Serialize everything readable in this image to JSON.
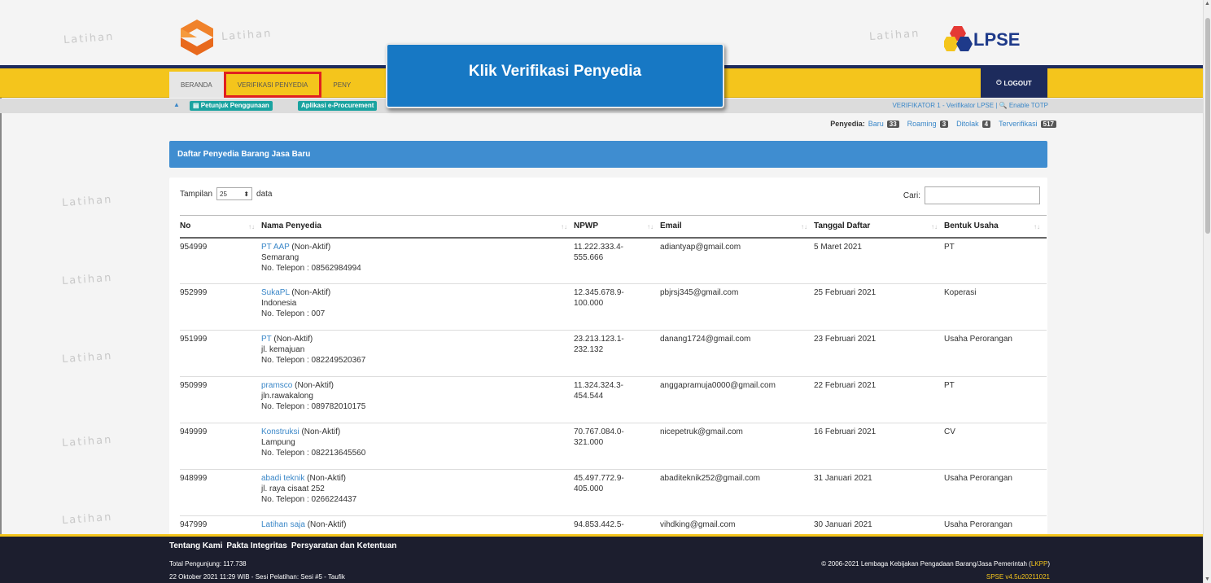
{
  "watermark": "Latihan",
  "header": {
    "lpse_label": "LPSE",
    "logout_label": "LOGOUT"
  },
  "nav": {
    "tabs": [
      {
        "label": "BERANDA"
      },
      {
        "label": "VERIFIKASI PENYEDIA"
      },
      {
        "label": "PENY"
      }
    ]
  },
  "subbar": {
    "petunjuk_label": "Petunjuk Penggunaan",
    "aplikasi_label": "Aplikasi e-Procurement",
    "user_info": "VERIFIKATOR 1 - Verifikator LPSE | ",
    "enable_totp": "Enable TOTP"
  },
  "counters": {
    "label": "Penyedia:",
    "items": [
      {
        "label": "Baru",
        "count": "33"
      },
      {
        "label": "Roaming",
        "count": "3"
      },
      {
        "label": "Ditolak",
        "count": "4"
      },
      {
        "label": "Terverifikasi",
        "count": "517"
      }
    ]
  },
  "callout": {
    "text": "Klik Verifikasi Penyedia"
  },
  "panel": {
    "title": "Daftar Penyedia Barang Jasa Baru",
    "show_label": "Tampilan",
    "page_size": "25",
    "show_suffix": "data",
    "search_label": "Cari:",
    "search_value": ""
  },
  "table": {
    "headers": [
      "No",
      "Nama Penyedia",
      "NPWP",
      "Email",
      "Tanggal Daftar",
      "Bentuk Usaha"
    ],
    "rows": [
      {
        "no": "954999",
        "nama": "PT AAP",
        "status": " (Non-Aktif)",
        "alamat": "Semarang",
        "telepon": "No. Telepon : 08562984994",
        "npwp1": "11.222.333.4-",
        "npwp2": "555.666",
        "email": "adiantyap@gmail.com",
        "tanggal": "5 Maret 2021",
        "bentuk": "PT"
      },
      {
        "no": "952999",
        "nama": "SukaPL",
        "status": " (Non-Aktif)",
        "alamat": "Indonesia",
        "telepon": "No. Telepon : 007",
        "npwp1": "12.345.678.9-",
        "npwp2": "100.000",
        "email": "pbjrsj345@gmail.com",
        "tanggal": "25 Februari 2021",
        "bentuk": "Koperasi"
      },
      {
        "no": "951999",
        "nama": "PT",
        "status": " (Non-Aktif)",
        "alamat": "jl. kemajuan",
        "telepon": "No. Telepon : 082249520367",
        "npwp1": "23.213.123.1-",
        "npwp2": "232.132",
        "email": "danang1724@gmail.com",
        "tanggal": "23 Februari 2021",
        "bentuk": "Usaha Perorangan"
      },
      {
        "no": "950999",
        "nama": "pramsco",
        "status": " (Non-Aktif)",
        "alamat": "jln.rawakalong",
        "telepon": "No. Telepon : 089782010175",
        "npwp1": "11.324.324.3-",
        "npwp2": "454.544",
        "email": "anggapramuja0000@gmail.com",
        "tanggal": "22 Februari 2021",
        "bentuk": "PT"
      },
      {
        "no": "949999",
        "nama": "Konstruksi",
        "status": " (Non-Aktif)",
        "alamat": "Lampung",
        "telepon": "No. Telepon : 082213645560",
        "npwp1": "70.767.084.0-",
        "npwp2": "321.000",
        "email": "nicepetruk@gmail.com",
        "tanggal": "16 Februari 2021",
        "bentuk": "CV"
      },
      {
        "no": "948999",
        "nama": "abadi teknik",
        "status": " (Non-Aktif)",
        "alamat": "jl. raya cisaat 252",
        "telepon": "No. Telepon : 0266224437",
        "npwp1": "45.497.772.9-",
        "npwp2": "405.000",
        "email": "abaditeknik252@gmail.com",
        "tanggal": "31 Januari 2021",
        "bentuk": "Usaha Perorangan"
      },
      {
        "no": "947999",
        "nama": "Latihan saja",
        "status": " (Non-Aktif)",
        "alamat": "",
        "telepon": "",
        "npwp1": "94.853.442.5-",
        "npwp2": "",
        "email": "vihdking@gmail.com",
        "tanggal": "30 Januari 2021",
        "bentuk": "Usaha Perorangan"
      }
    ]
  },
  "footer": {
    "links": [
      "Tentang Kami",
      "Pakta Integritas",
      "Persyaratan dan Ketentuan"
    ],
    "visitors": "Total Pengunjung: 117.738",
    "session": "22 Oktober 2021 11:29 WIB - Sesi Pelatihan: Sesi #5 - Taufik",
    "copyright": "© 2006-2021 Lembaga Kebijakan Pengadaan Barang/Jasa Pemerintah (",
    "lkpp": "LKPP",
    "copyright_end": ")",
    "version": "SPSE v4.5u20211021"
  },
  "colors": {
    "brand_yellow": "#f4c51c",
    "navy": "#1d2b5c",
    "panel_blue": "#3f8dd0",
    "callout_blue": "#1778c4",
    "highlight_red": "#e02020"
  }
}
